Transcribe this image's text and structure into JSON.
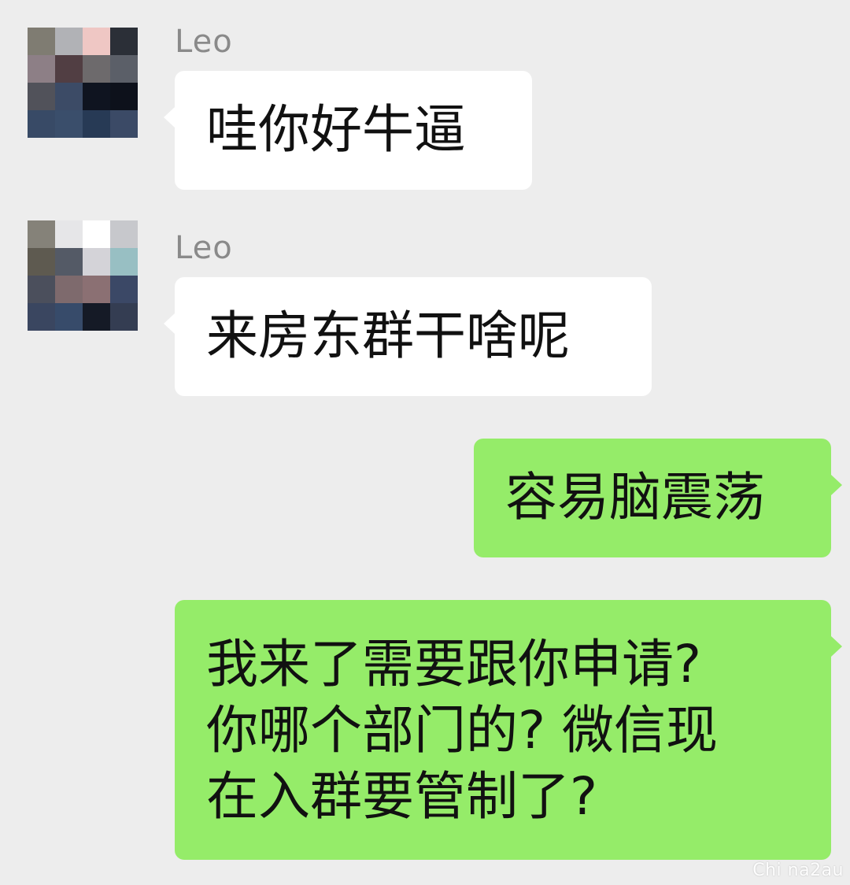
{
  "colors": {
    "background": "#ededed",
    "incoming_bubble": "#ffffff",
    "outgoing_bubble": "#95ec69",
    "sender_name": "#8a8a8a",
    "text": "#111111"
  },
  "messages": [
    {
      "direction": "incoming",
      "sender": "Leo",
      "text": "哇你好牛逼",
      "avatar_icon": "pixelated-avatar-icon"
    },
    {
      "direction": "incoming",
      "sender": "Leo",
      "text": "来房东群干啥呢",
      "avatar_icon": "pixelated-avatar-icon"
    },
    {
      "direction": "outgoing",
      "text": "容易脑震荡"
    },
    {
      "direction": "outgoing",
      "lines": [
        "我来了需要跟你申请?",
        "你哪个部门的? 微信现",
        "在入群要管制了?"
      ]
    }
  ],
  "watermark": "Chi na2au"
}
